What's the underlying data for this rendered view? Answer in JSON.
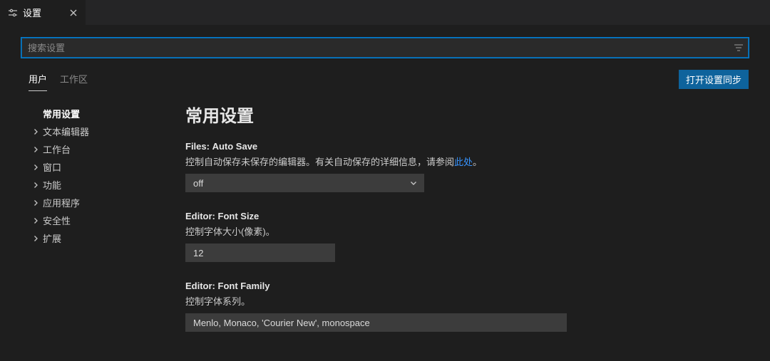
{
  "tab": {
    "title": "设置"
  },
  "search": {
    "placeholder": "搜索设置"
  },
  "scope": {
    "user": "用户",
    "workspace": "工作区"
  },
  "sync_button": "打开设置同步",
  "toc": {
    "items": [
      {
        "label": "常用设置",
        "expandable": false,
        "active": true
      },
      {
        "label": "文本编辑器",
        "expandable": true
      },
      {
        "label": "工作台",
        "expandable": true
      },
      {
        "label": "窗口",
        "expandable": true
      },
      {
        "label": "功能",
        "expandable": true
      },
      {
        "label": "应用程序",
        "expandable": true
      },
      {
        "label": "安全性",
        "expandable": true
      },
      {
        "label": "扩展",
        "expandable": true
      }
    ]
  },
  "section": {
    "title": "常用设置"
  },
  "settings": {
    "autosave": {
      "category": "Files:",
      "name": "Auto Save",
      "desc_prefix": "控制自动保存未保存的编辑器。有关自动保存的详细信息，请参阅",
      "desc_link": "此处",
      "desc_suffix": "。",
      "value": "off"
    },
    "fontsize": {
      "category": "Editor:",
      "name": "Font Size",
      "desc": "控制字体大小(像素)。",
      "value": "12"
    },
    "fontfamily": {
      "category": "Editor:",
      "name": "Font Family",
      "desc": "控制字体系列。",
      "value": "Menlo, Monaco, 'Courier New', monospace"
    }
  }
}
